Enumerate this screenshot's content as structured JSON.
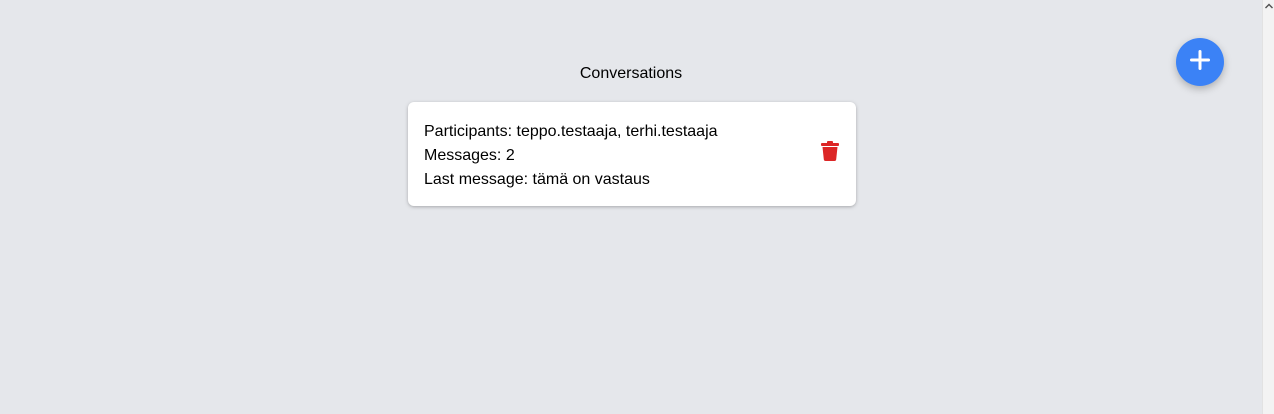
{
  "header": {
    "title": "Conversations"
  },
  "conversations": [
    {
      "participants_label": "Participants:",
      "participants": "teppo.testaaja, terhi.testaaja",
      "messages_label": "Messages:",
      "messages_count": "2",
      "last_message_label": "Last message:",
      "last_message": "tämä on vastaus",
      "delete_icon": "trash-icon"
    }
  ],
  "fab": {
    "icon": "plus-icon"
  },
  "colors": {
    "background": "#e5e7eb",
    "card": "#ffffff",
    "accent": "#3b82f6",
    "danger": "#dc2626"
  }
}
